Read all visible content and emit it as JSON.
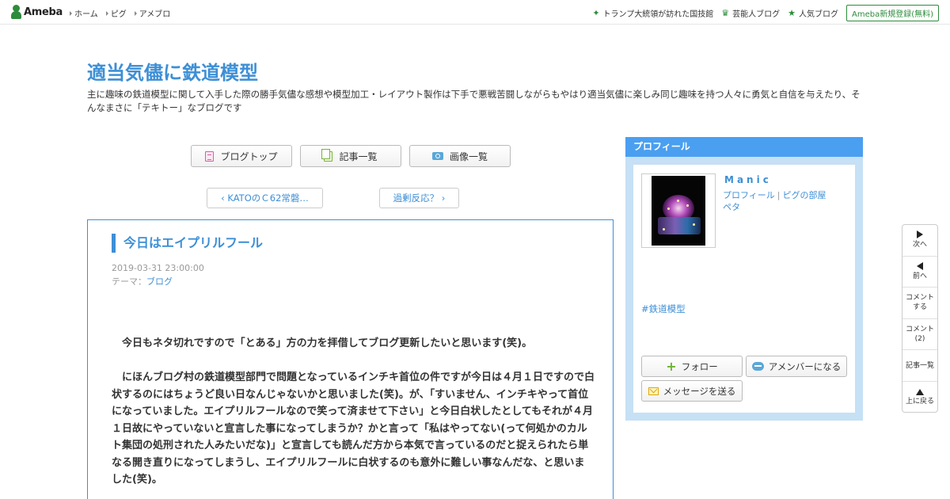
{
  "topbar": {
    "logo": "Ameba",
    "nav": [
      "ホーム",
      "ピグ",
      "アメブロ"
    ],
    "links": [
      {
        "label": "トランプ大統領が訪れた国技館",
        "icon": "sparkle-icon"
      },
      {
        "label": "芸能人ブログ",
        "icon": "crown-icon"
      },
      {
        "label": "人気ブログ",
        "icon": "star-icon"
      }
    ],
    "signup": "Ameba新規登録(無料)"
  },
  "header": {
    "title": "適当気儘に鉄道模型",
    "description": "主に趣味の鉄道模型に関して入手した際の勝手気儘な感想や模型加工・レイアウト製作は下手で悪戦苦闘しながらもやはり適当気儘に楽しみ同じ趣味を持つ人々に勇気と自信を与えたり、そんなまさに「テキトー」なブログです"
  },
  "nav": {
    "blog_top": "ブログトップ",
    "entries": "記事一覧",
    "images": "画像一覧",
    "prev": "KATOのＣ62常磐…",
    "next": "過剰反応？"
  },
  "article": {
    "title": "今日はエイプリルフール",
    "date": "2019-03-31 23:00:00",
    "theme_label": "テーマ：",
    "theme": "ブログ",
    "paragraphs": [
      "今日もネタ切れですので「とある」方の力を拝借してブログ更新したいと思います(笑)。",
      "にほんブログ村の鉄道模型部門で問題となっているインチキ首位の件ですが今日は４月１日ですので白状するのにはちょうど良い日なんじゃないかと思いました(笑)。が、「すいません、インチキやって首位になっていました。エイプリルフールなので笑って済ませて下さい」と今日白状したとしてもそれが４月１日故にやっていないと宣言した事になってしまうか？かと言って「私はやってない(って何処かのカルト集団の処刑された人みたいだな)」と宣言しても読んだ方から本気で言っているのだと捉えられたら単なる開き直りになってしまうし、エイプリルフールに白状するのも意外に難しい事なんだな、と思いました(笑)。"
    ]
  },
  "profile": {
    "header": "プロフィール",
    "name": "Manic",
    "link_profile": "プロフィール",
    "link_room": "ピグの部屋",
    "link_peta": "ペタ",
    "tag": "#鉄道模型",
    "follow": "フォロー",
    "member": "アメンバーになる",
    "message": "メッセージを送る"
  },
  "rail": {
    "next": "次へ",
    "prev": "前へ",
    "comment_line1": "コメント",
    "comment_line2": "する",
    "comments_line1": "コメント",
    "comments_line2": "(2)",
    "entries": "記事一覧",
    "top": "上に戻る"
  }
}
